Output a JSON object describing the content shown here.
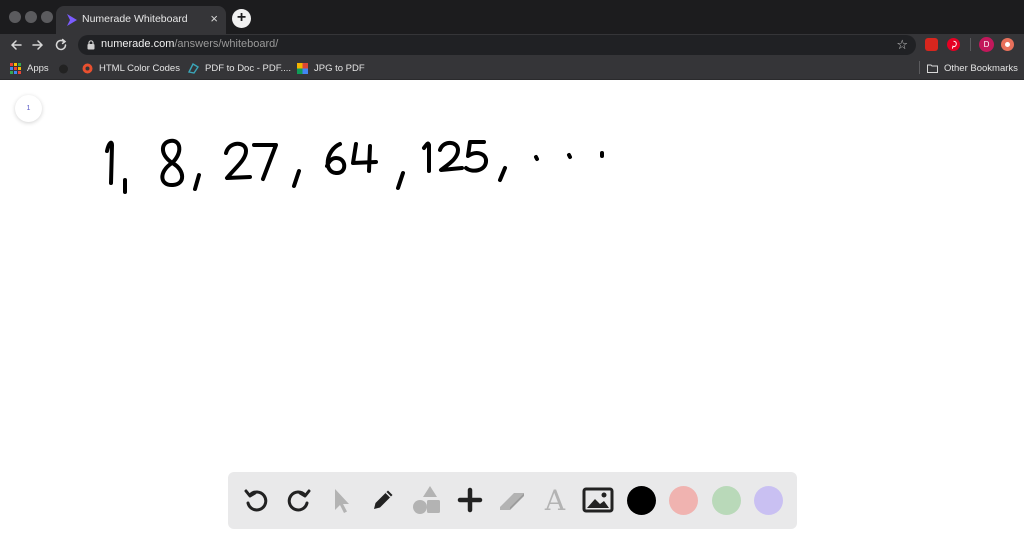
{
  "browser": {
    "tab": {
      "title": "Numerade Whiteboard",
      "close_glyph": "×"
    },
    "new_tab_glyph": "+",
    "address": {
      "host": "numerade.com",
      "path": "/answers/whiteboard/"
    },
    "profile_initial": "D",
    "bookmarks": [
      {
        "label": "Apps",
        "icon": "apps-grid-icon"
      },
      {
        "label": "HTML Color Codes",
        "icon": "color-codes-icon"
      },
      {
        "label": "PDF to Doc - PDF....",
        "icon": "pdf-to-doc-icon"
      },
      {
        "label": "JPG to PDF",
        "icon": "jpg-to-pdf-icon"
      }
    ],
    "other_bookmarks": "Other Bookmarks"
  },
  "whiteboard": {
    "page_number": "1",
    "handwriting": "1, 8, 27, 64, 125, . . .",
    "tools": [
      "undo-icon",
      "redo-icon",
      "pointer-icon",
      "pen-icon",
      "shapes-icon",
      "add-icon",
      "eraser-icon",
      "text-icon",
      "image-icon"
    ],
    "text_tool_glyph": "A",
    "colors": [
      "#000000",
      "#f0b3b0",
      "#b9d9b9",
      "#c9c0f2"
    ]
  }
}
